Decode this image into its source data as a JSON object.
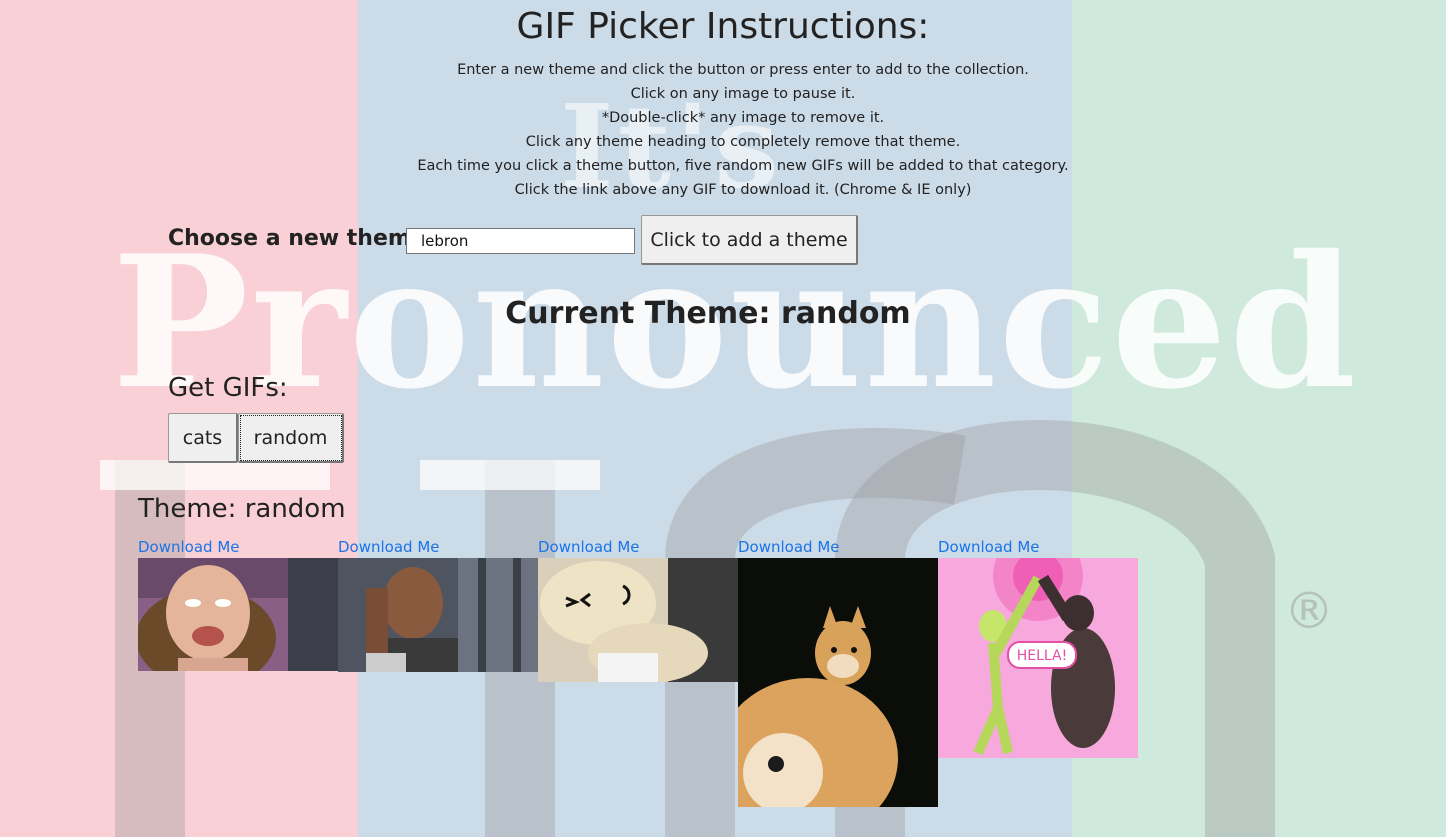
{
  "background": {
    "colors": [
      "#f9d0d6",
      "#ccdbe8",
      "#cfe9dc"
    ],
    "watermark_text_small": "It's",
    "watermark_text_large": "Pronounced",
    "watermark_registered": "®"
  },
  "header": {
    "title": "GIF Picker Instructions:",
    "instructions": [
      "Enter a new theme and click the button or press enter to add to the collection.",
      "Click on any image to pause it.",
      "*Double-click* any image to remove it.",
      "Click any theme heading to completely remove that theme.",
      "Each time you click a theme button, five random new GIFs will be added to that category.",
      "Click the link above any GIF to download it. (Chrome & IE only)"
    ]
  },
  "theme_form": {
    "label": "Choose a new theme",
    "input_value": "lebron",
    "button_label": "Click to add a theme"
  },
  "current_theme": "Current Theme: random",
  "get_gifs": {
    "heading": "Get GIFs:",
    "buttons": [
      "cats",
      "random"
    ]
  },
  "theme_section": {
    "title": "Theme: random",
    "gifs": [
      {
        "link": "Download Me",
        "subject": "woman-making-face"
      },
      {
        "link": "Download Me",
        "subject": "man-thinking"
      },
      {
        "link": "Download Me",
        "subject": "cartoon-dumpling"
      },
      {
        "link": "Download Me",
        "subject": "doge-dog"
      },
      {
        "link": "Download Me",
        "subject": "alien-gorilla-high-five",
        "caption": "HELLA!"
      }
    ]
  }
}
